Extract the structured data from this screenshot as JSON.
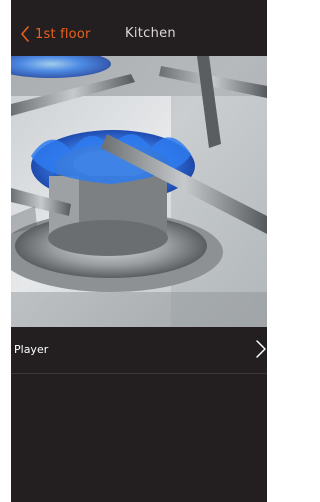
{
  "header": {
    "back_label": "1st floor",
    "title": "Kitchen"
  },
  "camera": {
    "icon": "gas-burner-camera-image"
  },
  "list": {
    "items": [
      {
        "label": "Player",
        "icon": "chevron-right-icon"
      }
    ]
  },
  "colors": {
    "background": "#231f20",
    "accent": "#e8601c",
    "title": "#d9d9d9",
    "row_text": "#ffffff"
  }
}
